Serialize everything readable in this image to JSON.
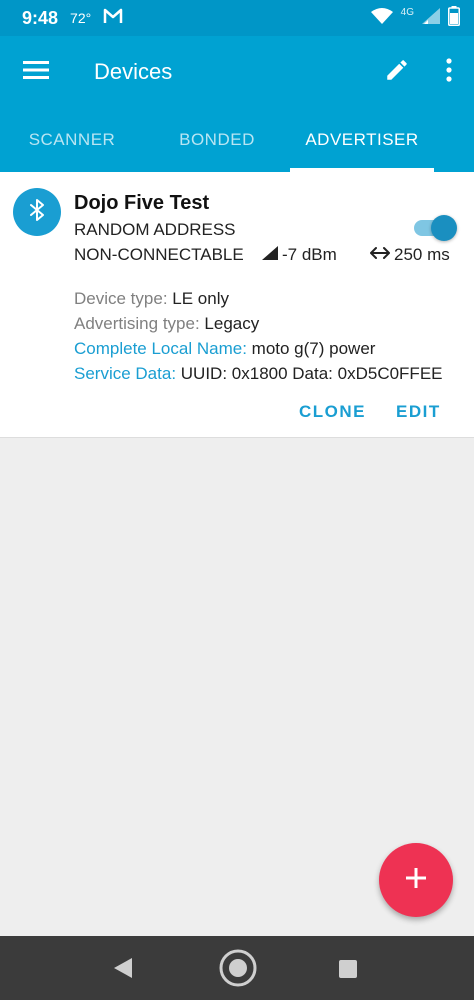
{
  "status_bar": {
    "time": "9:48",
    "temperature": "72°",
    "mail_icon": "gmail-icon",
    "network_label": "4G",
    "battery_text": "73"
  },
  "app_bar": {
    "title": "Devices",
    "menu_icon": "menu-icon",
    "edit_icon": "pencil-icon",
    "overflow_icon": "more-vert-icon"
  },
  "tabs": [
    {
      "label": "SCANNER",
      "active": false
    },
    {
      "label": "BONDED",
      "active": false
    },
    {
      "label": "ADVERTISER",
      "active": true
    }
  ],
  "advertiser": {
    "name": "Dojo Five Test",
    "address_type": "RANDOM ADDRESS",
    "connectable": "NON-CONNECTABLE",
    "tx_power": "-7 dBm",
    "interval": "250 ms",
    "enabled": true,
    "details": {
      "device_type_label": "Device type:",
      "device_type_value": "LE only",
      "adv_type_label": "Advertising type:",
      "adv_type_value": "Legacy",
      "local_name_label": "Complete Local Name:",
      "local_name_value": "moto g(7) power",
      "service_data_label": "Service Data:",
      "service_data_value": "UUID: 0x1800 Data: 0xD5C0FFEE"
    },
    "clone_label": "CLONE",
    "edit_label": "EDIT"
  },
  "fab": {
    "icon": "plus-icon"
  },
  "colors": {
    "primary": "#00a2d2",
    "status_bar": "#0096c7",
    "accent": "#1a9ed2",
    "fab": "#ee3253"
  }
}
